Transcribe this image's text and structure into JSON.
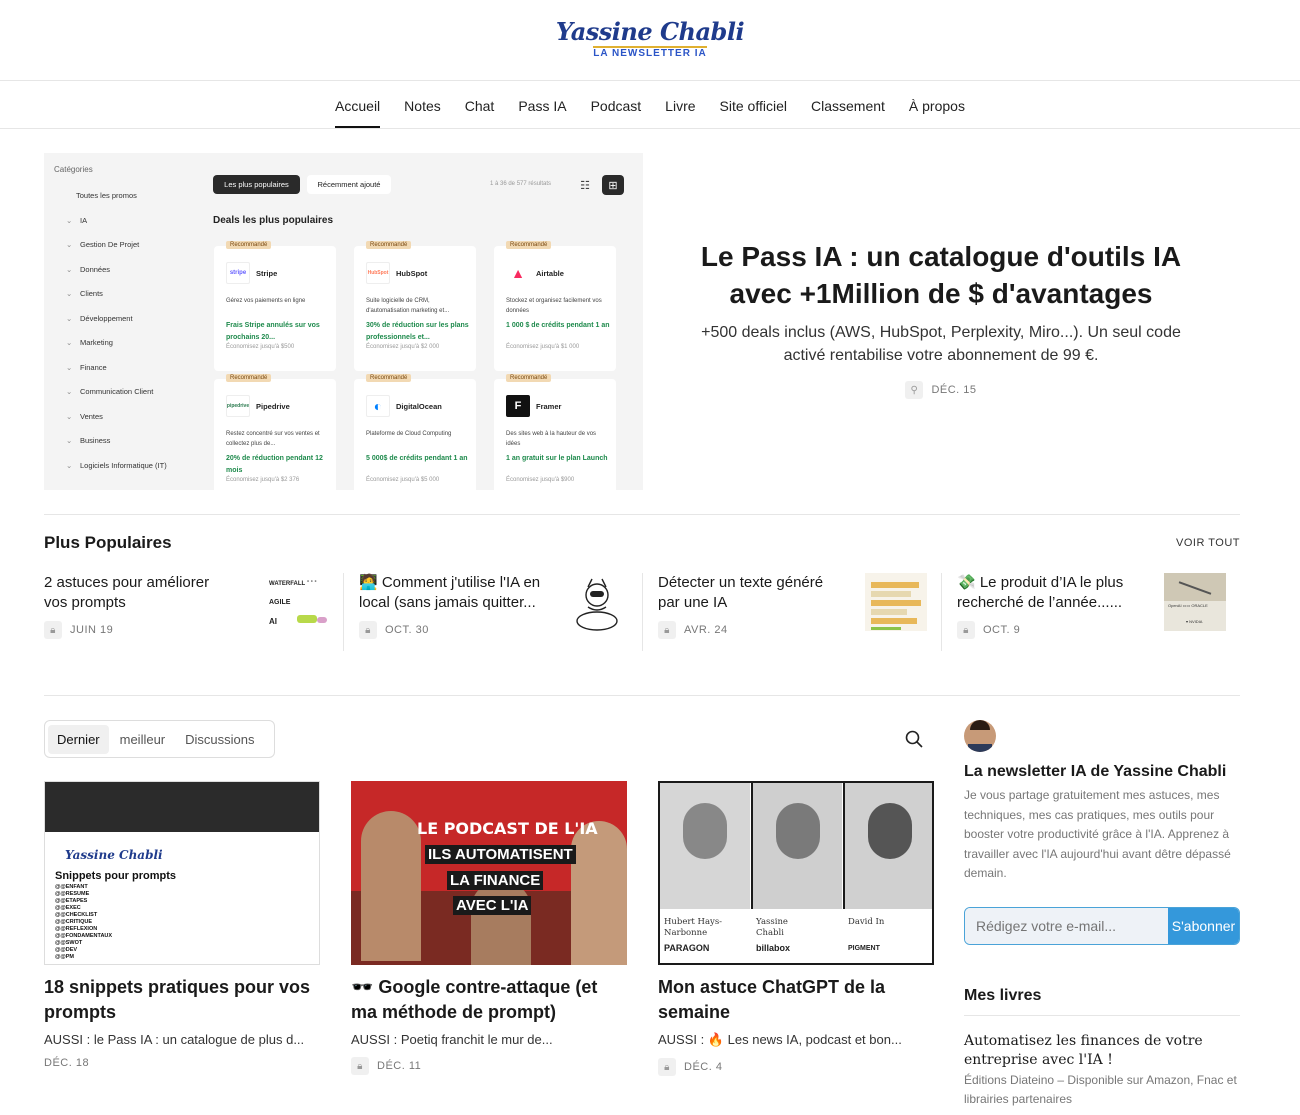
{
  "site": {
    "logo_line1": "Yassine Chabli",
    "logo_line2": "LA NEWSLETTER IA"
  },
  "nav": [
    "Accueil",
    "Notes",
    "Chat",
    "Pass IA",
    "Podcast",
    "Livre",
    "Site officiel",
    "Classement",
    "À propos"
  ],
  "hero": {
    "title": "Le Pass IA : un catalogue d'outils IA avec +1Million de $ d'avantages",
    "subtitle": "+500 deals inclus (AWS, HubSpot, Perplexity, Miro...). Un seul code activé rentabilise votre abonnement de 99 €.",
    "date": "DÉC. 15",
    "screenshot": {
      "categories_title": "Catégories",
      "categories": [
        "Toutes les promos",
        "IA",
        "Gestion De Projet",
        "Données",
        "Clients",
        "Développement",
        "Marketing",
        "Finance",
        "Communication Client",
        "Ventes",
        "Business",
        "Logiciels Informatique (IT)"
      ],
      "btn_popular": "Les plus populaires",
      "btn_recent": "Récemment ajouté",
      "results": "1 à 36 de 577 résultats",
      "deals_heading": "Deals les plus populaires",
      "badge": "Recommandé",
      "cards": [
        {
          "name": "Stripe",
          "logo": "stripe",
          "desc": "Gérez vos paiements en ligne",
          "offer": "Frais Stripe annulés sur vos prochains 20...",
          "save": "Économisez jusqu'à $500"
        },
        {
          "name": "HubSpot",
          "logo": "HubSpot",
          "desc": "Suite logicielle de CRM, d'automatisation marketing et...",
          "offer": "30% de réduction sur les plans professionnels et...",
          "save": "Économisez jusqu'à $2 000"
        },
        {
          "name": "Airtable",
          "logo": "▲",
          "desc": "Stockez et organisez facilement vos données",
          "offer": "1 000 $ de crédits pendant 1 an",
          "save": "Économisez jusqu'à $1 000"
        },
        {
          "name": "Pipedrive",
          "logo": "pipedrive",
          "desc": "Restez concentré sur vos ventes et collectez plus de...",
          "offer": "20% de réduction pendant 12 mois",
          "save": "Économisez jusqu'à $2 376"
        },
        {
          "name": "DigitalOcean",
          "logo": "◐",
          "desc": "Plateforme de Cloud Computing",
          "offer": "5 000$ de crédits pendant 1 an",
          "save": "Économisez jusqu'à $5 000"
        },
        {
          "name": "Framer",
          "logo": "F",
          "desc": "Des sites web à la hauteur de vos idées",
          "offer": "1 an gratuit sur le plan Launch",
          "save": "Économisez jusqu'à $900"
        }
      ]
    }
  },
  "popular": {
    "heading": "Plus Populaires",
    "see_all": "VOIR TOUT",
    "items": [
      {
        "title": "2 astuces pour améliorer vos prompts",
        "date": "JUIN 19"
      },
      {
        "title": "🧑‍💻 Comment j'utilise l'IA en local (sans jamais quitter...",
        "date": "OCT. 30"
      },
      {
        "title": "Détecter un texte généré par une IA",
        "date": "AVR. 24"
      },
      {
        "title": "💸 Le produit d’IA le plus recherché de l’année......",
        "date": "OCT. 9"
      }
    ],
    "thumb1": {
      "a": "WATERFALL",
      "b": "AGILE",
      "c": "AI"
    }
  },
  "feed": {
    "tabs": [
      "Dernier",
      "meilleur",
      "Discussions"
    ],
    "posts": [
      {
        "title": "18 snippets pratiques pour vos prompts",
        "aussi": "AUSSI : le Pass IA : un catalogue de plus d...",
        "date": "DÉC. 18",
        "img": {
          "heading": "Snippets pour prompts",
          "logo": "Yassine Chabli",
          "rows": [
            "@@ENFANT",
            "@@RESUME",
            "@@ETAPES",
            "@@EXEC",
            "@@CHECKLIST",
            "@@CRITIQUE",
            "@@REFLEXION",
            "@@FONDAMENTAUX",
            "@@SWOT",
            "@@DEV",
            "@@PM"
          ]
        }
      },
      {
        "title": "🕶️ Google contre-attaque (et ma méthode de prompt)",
        "aussi": "AUSSI : Poetiq franchit le mur de...",
        "date": "DÉC. 11",
        "img": {
          "l1": "LE PODCAST DE L'IA",
          "l2": "ILS AUTOMATISENT",
          "l3": "LA FINANCE",
          "l4": "AVEC L'IA"
        }
      },
      {
        "title": "Mon astuce ChatGPT de la semaine",
        "aussi": "AUSSI : 🔥 Les news IA, podcast et bon...",
        "date": "DÉC. 4",
        "img": {
          "p1": "Hubert Hays-Narbonne",
          "c1": "PARAGON",
          "p2": "Yassine Chabli",
          "c2": "billabox",
          "p3": "David In",
          "c3": "PIGMENT"
        }
      }
    ]
  },
  "sidebar": {
    "title": "La newsletter IA de Yassine Chabli",
    "desc": "Je vous partage gratuitement mes astuces, mes techniques, mes cas pratiques, mes outils pour booster votre productivité grâce à l'IA. Apprenez à travailler avec l'IA aujourd'hui avant dêtre dépassé demain.",
    "email_placeholder": "Rédigez votre e-mail...",
    "subscribe": "S'abonner",
    "books_heading": "Mes livres",
    "book_title": "Automatisez les finances de votre entreprise avec l'IA !",
    "book_sub": "Éditions Diateino – Disponible sur Amazon, Fnac et librairies partenaires"
  }
}
